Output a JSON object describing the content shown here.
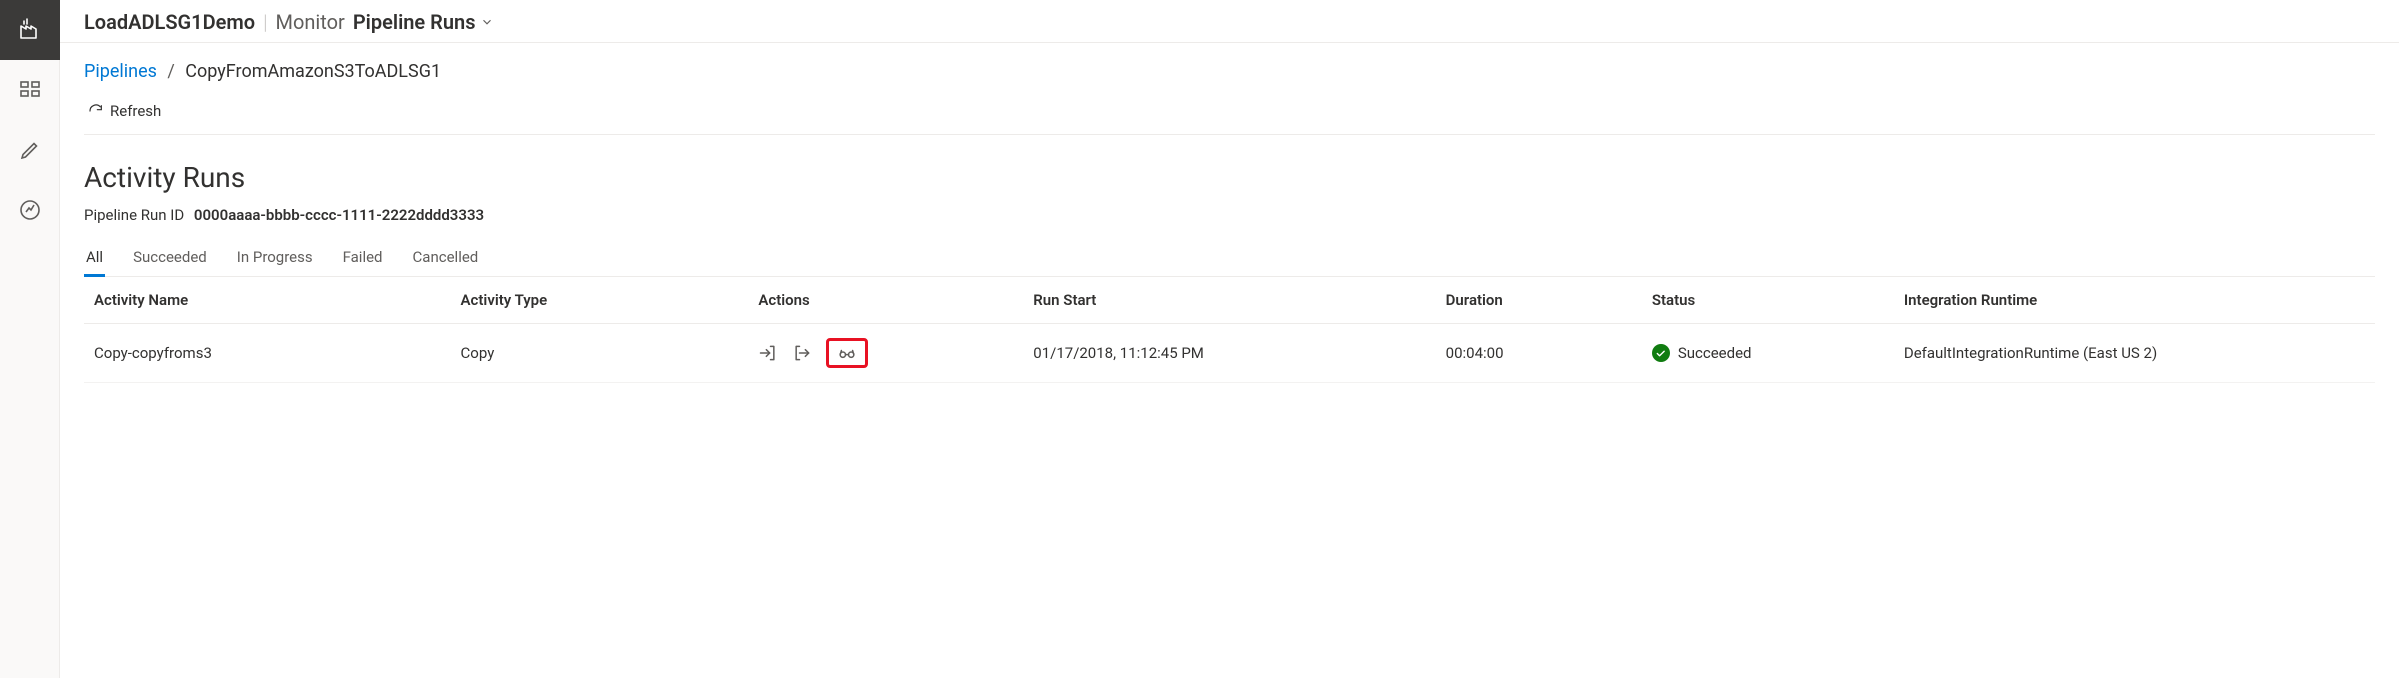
{
  "topbar": {
    "resource_name": "LoadADLSG1Demo",
    "section": "Monitor",
    "subsection": "Pipeline Runs"
  },
  "breadcrumb": {
    "root": "Pipelines",
    "current": "CopyFromAmazonS3ToADLSG1"
  },
  "toolbar": {
    "refresh_label": "Refresh"
  },
  "page": {
    "section_title": "Activity Runs",
    "run_id_label": "Pipeline Run ID",
    "run_id_value": "0000aaaa-bbbb-cccc-1111-2222dddd3333"
  },
  "tabs": [
    {
      "label": "All",
      "active": true
    },
    {
      "label": "Succeeded",
      "active": false
    },
    {
      "label": "In Progress",
      "active": false
    },
    {
      "label": "Failed",
      "active": false
    },
    {
      "label": "Cancelled",
      "active": false
    }
  ],
  "table": {
    "headers": {
      "activity_name": "Activity Name",
      "activity_type": "Activity Type",
      "actions": "Actions",
      "run_start": "Run Start",
      "duration": "Duration",
      "status": "Status",
      "integration_runtime": "Integration Runtime"
    },
    "rows": [
      {
        "activity_name": "Copy-copyfroms3",
        "activity_type": "Copy",
        "run_start": "01/17/2018, 11:12:45 PM",
        "duration": "00:04:00",
        "status": "Succeeded",
        "integration_runtime": "DefaultIntegrationRuntime (East US 2)"
      }
    ]
  }
}
